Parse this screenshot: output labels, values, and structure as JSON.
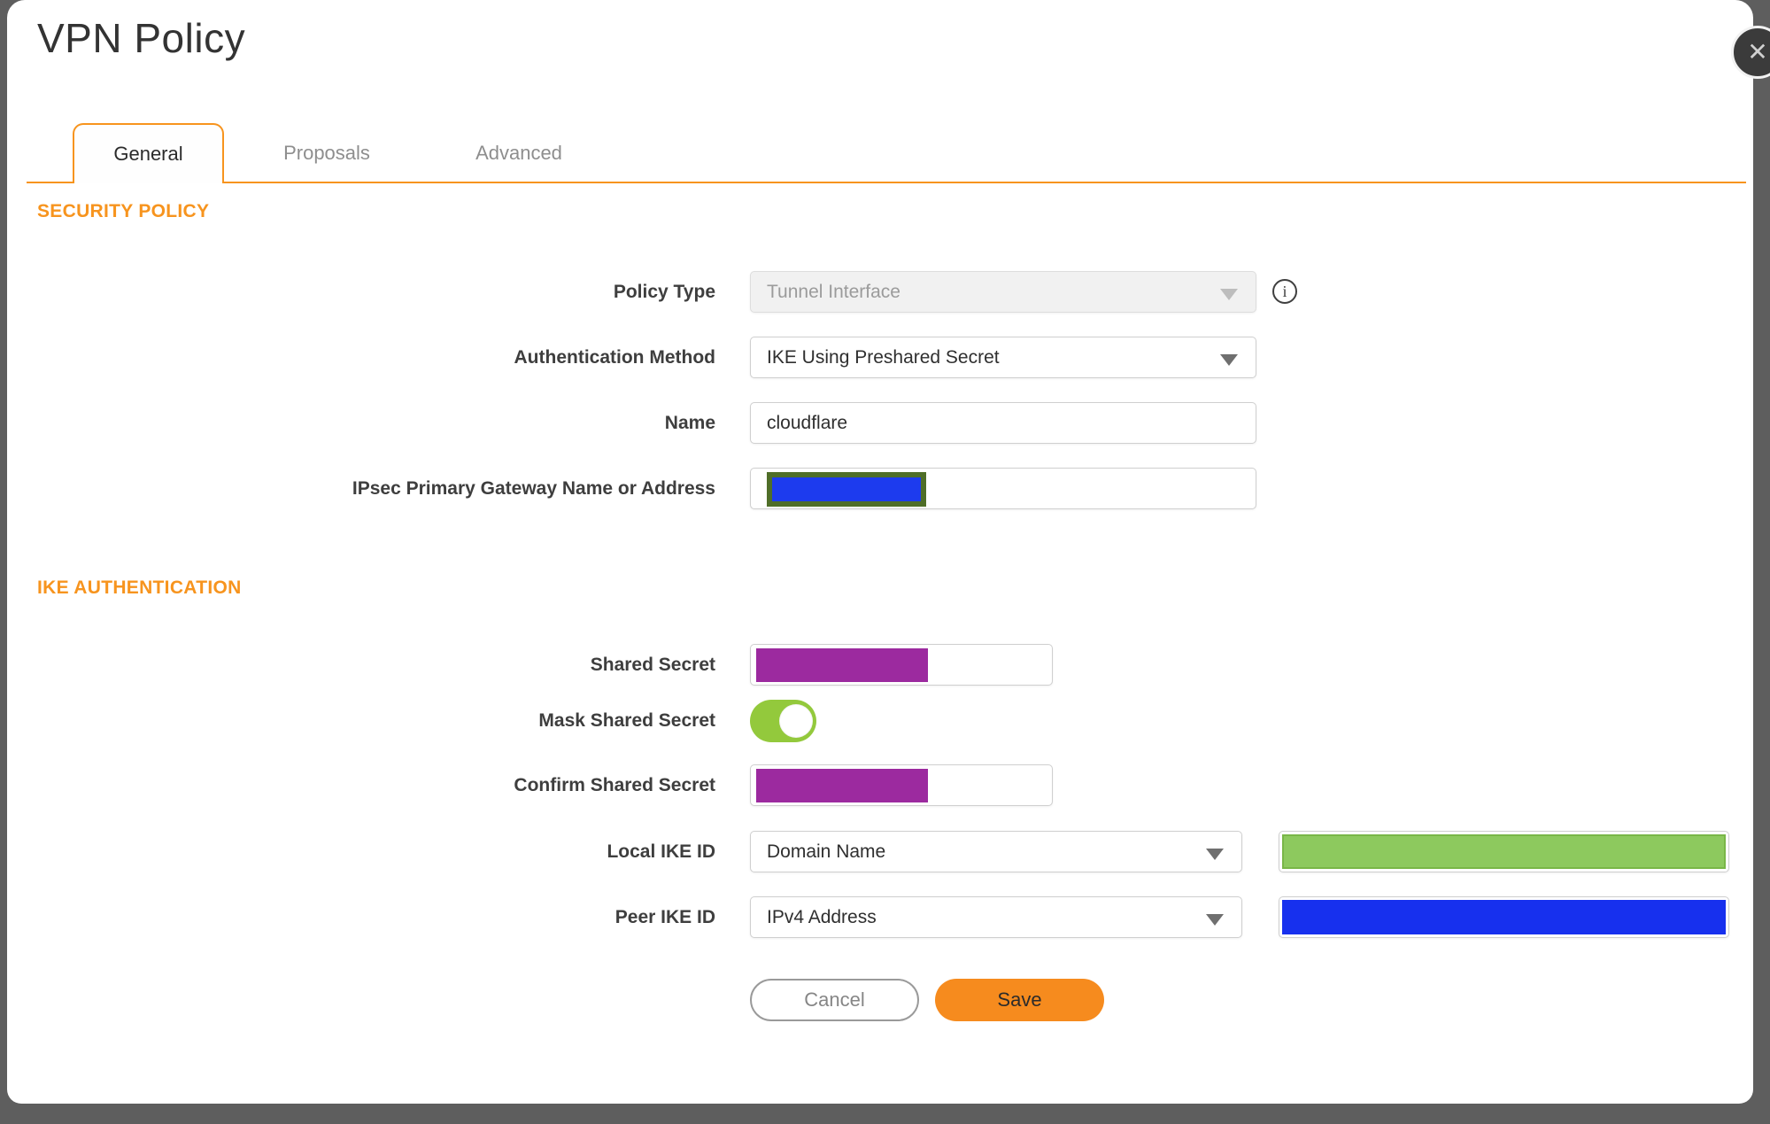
{
  "dialog": {
    "title": "VPN Policy",
    "close_icon": "✕"
  },
  "tabs": [
    {
      "label": "General",
      "active": true
    },
    {
      "label": "Proposals",
      "active": false
    },
    {
      "label": "Advanced",
      "active": false
    }
  ],
  "sections": {
    "security_policy": {
      "heading": "SECURITY POLICY"
    },
    "ike_authentication": {
      "heading": "IKE AUTHENTICATION"
    }
  },
  "fields": {
    "policy_type": {
      "label": "Policy Type",
      "value": "Tunnel Interface",
      "disabled": true
    },
    "authentication_method": {
      "label": "Authentication Method",
      "value": "IKE Using Preshared Secret"
    },
    "name": {
      "label": "Name",
      "value": "cloudflare"
    },
    "ipsec_gateway": {
      "label": "IPsec Primary Gateway Name or Address",
      "value": "",
      "redacted": true
    },
    "shared_secret": {
      "label": "Shared Secret",
      "value": "",
      "redacted": true
    },
    "mask_shared_secret": {
      "label": "Mask Shared Secret",
      "state": "on"
    },
    "confirm_shared_secret": {
      "label": "Confirm Shared Secret",
      "value": "",
      "redacted": true
    },
    "local_ike_id": {
      "label": "Local IKE ID",
      "value": "Domain Name",
      "id_value_redacted": true
    },
    "peer_ike_id": {
      "label": "Peer IKE ID",
      "value": "IPv4 Address",
      "id_value_redacted": true
    }
  },
  "buttons": {
    "cancel": "Cancel",
    "save": "Save"
  },
  "info_icon_glyph": "i",
  "colors": {
    "accent_orange": "#F7941E",
    "save_orange": "#F68B1E",
    "redact_purple": "#9C2A9F",
    "redact_blue": "#1D3BEE",
    "redact_green": "#8DC95E",
    "redact_olive": "#4F6E28",
    "toggle_green": "#93C93C"
  }
}
